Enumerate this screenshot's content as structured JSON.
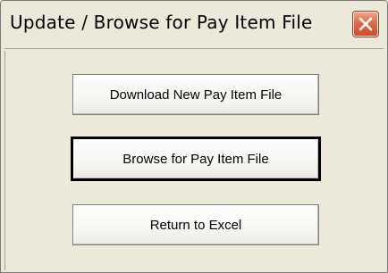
{
  "window": {
    "title": "Update / Browse for  Pay Item File"
  },
  "buttons": {
    "download_label": "Download New Pay Item File",
    "browse_label": "Browse for Pay Item File",
    "return_label": "Return to Excel"
  },
  "icons": {
    "close": "close-icon"
  },
  "colors": {
    "dialog_background": "#ece9d8",
    "close_button": "#d24a2a"
  }
}
